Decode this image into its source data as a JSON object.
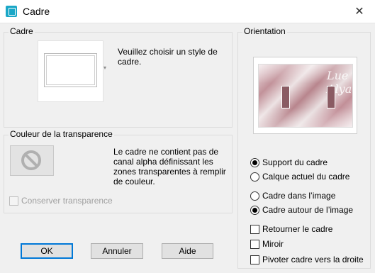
{
  "window": {
    "title": "Cadre",
    "close_label": "✕"
  },
  "cadre_group": {
    "label": "Cadre",
    "instruction": "Veuillez choisir un style de cadre."
  },
  "transparency_group": {
    "label": "Couleur de la transparence",
    "message": "Le cadre ne contient pas de canal alpha définissant les zones transparentes à remplir de couleur.",
    "keep_transparency_label": "Conserver transparence",
    "keep_transparency_checked": false,
    "keep_transparency_enabled": false
  },
  "orientation_group": {
    "label": "Orientation",
    "preview_signature": "Lue Alya",
    "apply_to": [
      {
        "label": "Support du cadre",
        "selected": true
      },
      {
        "label": "Calque actuel du cadre",
        "selected": false
      }
    ],
    "frame_position": [
      {
        "label": "Cadre dans l’image",
        "selected": false
      },
      {
        "label": "Cadre autour de l’image",
        "selected": true
      }
    ],
    "options": [
      {
        "label": "Retourner le cadre",
        "checked": false
      },
      {
        "label": "Miroir",
        "checked": false
      },
      {
        "label": "Pivoter cadre vers la droite",
        "checked": false
      }
    ]
  },
  "buttons": {
    "ok": "OK",
    "cancel": "Annuler",
    "help": "Aide"
  }
}
